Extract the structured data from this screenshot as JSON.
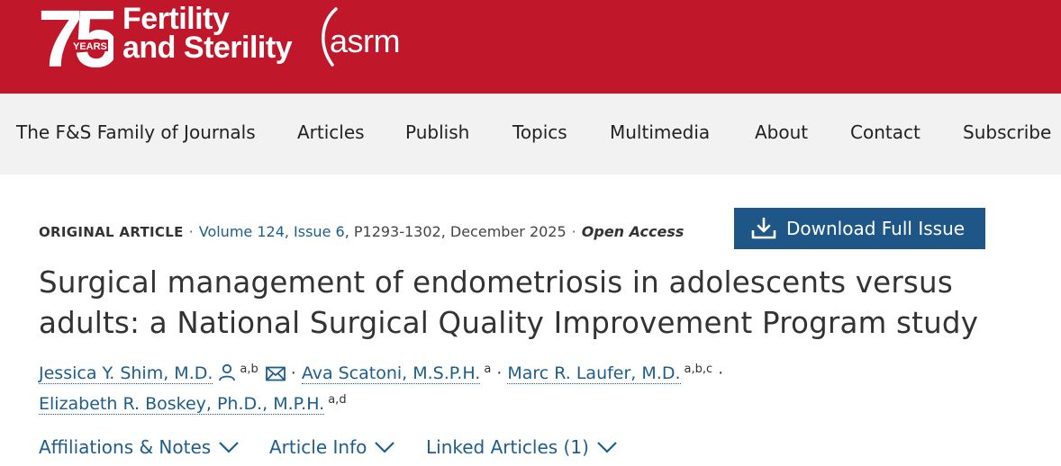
{
  "header": {
    "logo_number": "75",
    "logo_years": "YEARS",
    "brand_line1": "Fertility",
    "brand_line2": "and Sterility",
    "brand_reg": "®",
    "asrm": "asrm",
    "colors": {
      "brand_red": "#c0172b",
      "link_blue": "#1c5d8f",
      "button_blue": "#1f5688"
    }
  },
  "nav": {
    "items": [
      "The F&S Family of Journals",
      "Articles",
      "Publish",
      "Topics",
      "Multimedia",
      "About",
      "Contact",
      "Subscribe"
    ]
  },
  "article": {
    "type": "ORIGINAL ARTICLE",
    "sep": "·",
    "volume": "Volume 124, Issue 6",
    "pages_date": ", P1293-1302, December 2025",
    "access": "Open Access",
    "download_label": "Download Full Issue",
    "title": "Surgical management of endometriosis in adolescents versus adults: a National Surgical Quality Improvement Program study",
    "authors": [
      {
        "name": "Jessica Y. Shim, M.D.",
        "sup": "a,b"
      },
      {
        "name": "Ava Scatoni, M.S.P.H.",
        "sup": "a"
      },
      {
        "name": "Marc R. Laufer, M.D.",
        "sup": "a,b,c"
      },
      {
        "name": "Elizabeth R. Boskey, Ph.D., M.P.H.",
        "sup": "a,d"
      }
    ]
  },
  "tabs": [
    "Affiliations & Notes",
    "Article Info",
    "Linked Articles (1)"
  ]
}
